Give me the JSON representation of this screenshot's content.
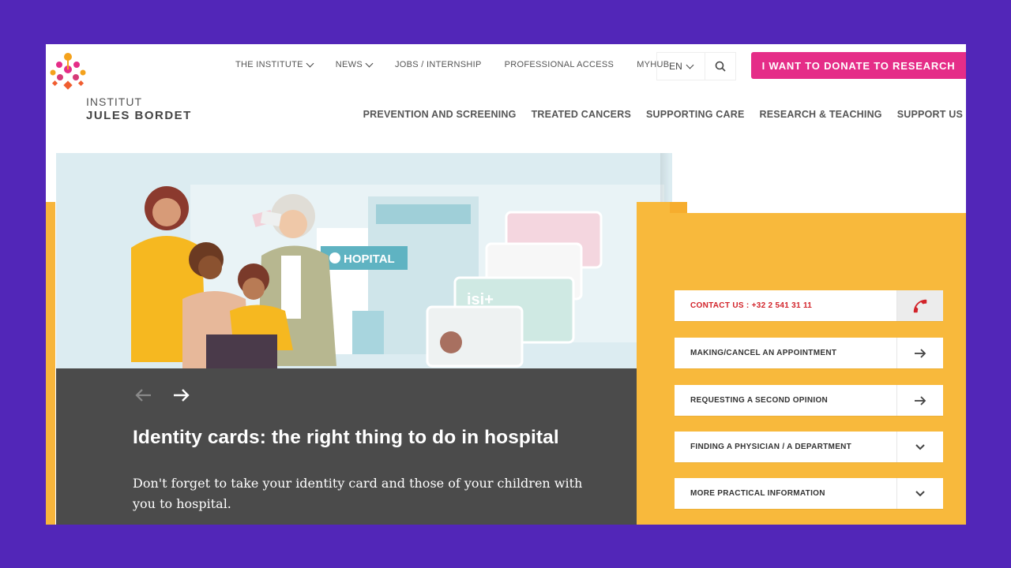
{
  "brand": {
    "line1": "INSTITUT",
    "line2": "JULES BORDET"
  },
  "topnav": [
    {
      "label": "THE INSTITUTE",
      "has_dropdown": true
    },
    {
      "label": "NEWS",
      "has_dropdown": true
    },
    {
      "label": "JOBS / INTERNSHIP",
      "has_dropdown": false
    },
    {
      "label": "PROFESSIONAL ACCESS",
      "has_dropdown": false
    },
    {
      "label": "MYHUB",
      "has_dropdown": false
    }
  ],
  "language": "EN",
  "donate_label": "I WANT TO DONATE TO RESEARCH",
  "mainnav": [
    "PREVENTION AND SCREENING",
    "TREATED CANCERS",
    "SUPPORTING CARE",
    "RESEARCH & TEACHING",
    "SUPPORT US"
  ],
  "hero": {
    "image_sign": "HOPITAL",
    "card_text": "isi+",
    "title": "Identity cards: the right thing to do in hospital",
    "text": "Don't forget to take your identity card and those of your children with you to hospital."
  },
  "quick_links": [
    {
      "label": "CONTACT US : +32 2 541 31 11",
      "icon": "phone-icon"
    },
    {
      "label": "MAKING/CANCEL AN APPOINTMENT",
      "icon": "arrow-right-icon"
    },
    {
      "label": "REQUESTING A SECOND OPINION",
      "icon": "arrow-right-icon"
    },
    {
      "label": "FINDING A PHYSICIAN / A DEPARTMENT",
      "icon": "chevron-down-icon"
    },
    {
      "label": "MORE PRACTICAL INFORMATION",
      "icon": "chevron-down-icon"
    }
  ],
  "colors": {
    "frame": "#5226b8",
    "accent_pink": "#e52d88",
    "panel_yellow": "#f8b93c",
    "hero_dark": "#4b4b4b",
    "contact_red": "#d2232a"
  }
}
